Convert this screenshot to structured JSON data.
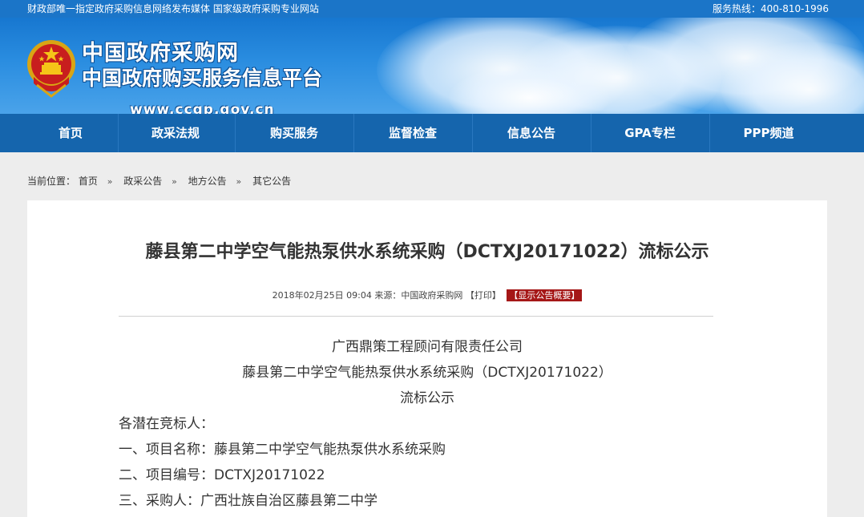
{
  "topbar": {
    "left_text": "财政部唯一指定政府采购信息网络发布媒体  国家级政府采购专业网站",
    "hotline": "服务热线：400-810-1996"
  },
  "banner": {
    "title": "中国政府采购网",
    "subtitle": "中国政府购买服务信息平台",
    "url": "www.ccgp.gov.cn",
    "emblem_icon": "national-emblem-icon"
  },
  "nav": {
    "items": [
      {
        "label": "首页"
      },
      {
        "label": "政采法规"
      },
      {
        "label": "购买服务"
      },
      {
        "label": "监督检查"
      },
      {
        "label": "信息公告"
      },
      {
        "label": "GPA专栏"
      },
      {
        "label": "PPP频道"
      }
    ]
  },
  "breadcrumb": {
    "prefix": "当前位置：",
    "items": [
      "首页",
      "政采公告",
      "地方公告",
      "其它公告"
    ],
    "separator": "»"
  },
  "article": {
    "title": "藤县第二中学空气能热泵供水系统采购（DCTXJ20171022）流标公示",
    "meta": "2018年02月25日 09:04 来源：中国政府采购网",
    "print_label": "【打印】",
    "summary_button": "【显示公告概要】",
    "header_lines": [
      "广西鼎策工程顾问有限责任公司",
      "藤县第二中学空气能热泵供水系统采购（DCTXJ20171022）",
      "流标公示"
    ],
    "body_lines": [
      "各潜在竞标人：",
      "一、项目名称：藤县第二中学空气能热泵供水系统采购",
      "二、项目编号：DCTXJ20171022",
      "三、采购人：广西壮族自治区藤县第二中学"
    ]
  },
  "colors": {
    "topbar": "#1b75c8",
    "nav": "#1565ad",
    "summary_button": "#a51717",
    "page_bg": "#ededed"
  }
}
